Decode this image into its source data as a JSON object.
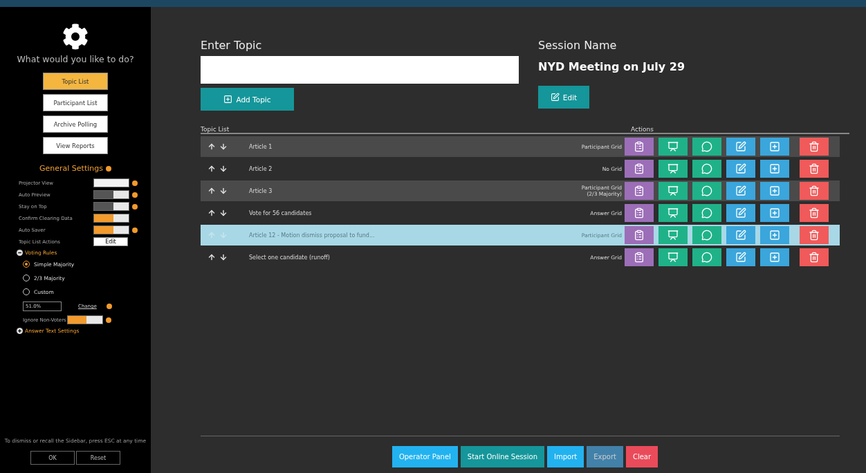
{
  "sidebar": {
    "heading": "What would you like to do?",
    "nav": [
      {
        "label": "Topic List",
        "selected": true
      },
      {
        "label": "Participant List",
        "selected": false
      },
      {
        "label": "Archive Polling",
        "selected": false
      },
      {
        "label": "View Reports",
        "selected": false
      }
    ],
    "general_settings": {
      "title": "General Settings",
      "toggles": [
        {
          "label": "Projector View",
          "kind": "off",
          "info": true
        },
        {
          "label": "Auto Preview",
          "kind": "dark",
          "info": true
        },
        {
          "label": "Stay on Top",
          "kind": "dark",
          "info": true
        },
        {
          "label": "Confirm Clearing Data",
          "kind": "orange",
          "info": false
        },
        {
          "label": "Auto Saver",
          "kind": "orange",
          "info": true
        }
      ],
      "topic_list_actions": {
        "label": "Topic List Actions",
        "button": "Edit"
      }
    },
    "voting_rules": {
      "title": "Voting Rules",
      "expanded": true,
      "options": [
        {
          "label": "Simple Majority",
          "selected": true
        },
        {
          "label": "2/3 Majority",
          "selected": false
        },
        {
          "label": "Custom",
          "selected": false
        }
      ],
      "custom_value": "51.0%",
      "change": "Change",
      "ignore_non_voters": {
        "label": "Ignore Non-Voters",
        "kind": "orange"
      }
    },
    "answer_text_settings": {
      "title": "Answer Text Settings",
      "expanded": false
    },
    "hint": "To dismiss or recall the Sidebar, press ESC at any time",
    "buttons": [
      "OK",
      "Reset"
    ]
  },
  "topic": {
    "label": "Enter Topic",
    "button": "Add Topic"
  },
  "session": {
    "label": "Session Name",
    "name": "NYD Meeting on July 29",
    "button": "Edit"
  },
  "table": {
    "columns": [
      "Topic List",
      "Actions"
    ],
    "rows": [
      {
        "topic": "Article 1",
        "grid": "Participant Grid",
        "shaded": true,
        "selected": false
      },
      {
        "topic": "Article 2",
        "grid": "No Grid",
        "shaded": false,
        "selected": false
      },
      {
        "topic": "Article 3",
        "grid": "Participant Grid\n(2/3 Majority)",
        "shaded": true,
        "selected": false
      },
      {
        "topic": "Vote for 56 candidates",
        "grid": "Answer Grid",
        "shaded": false,
        "selected": false
      },
      {
        "topic": "Article 12 - Motion dismiss proposal to fund...",
        "grid": "Participant Grid",
        "shaded": false,
        "selected": true
      },
      {
        "topic": "Select one candidate (runoff)",
        "grid": "Answer Grid",
        "shaded": false,
        "selected": false
      }
    ]
  },
  "footer_buttons": [
    {
      "label": "Operator Panel",
      "kind": "sky",
      "disabled": false
    },
    {
      "label": "Start Online Session",
      "kind": "teal",
      "disabled": false
    },
    {
      "label": "Import",
      "kind": "sky",
      "disabled": false
    },
    {
      "label": "Export",
      "kind": "sky",
      "disabled": true
    },
    {
      "label": "Clear",
      "kind": "red",
      "disabled": false
    }
  ]
}
